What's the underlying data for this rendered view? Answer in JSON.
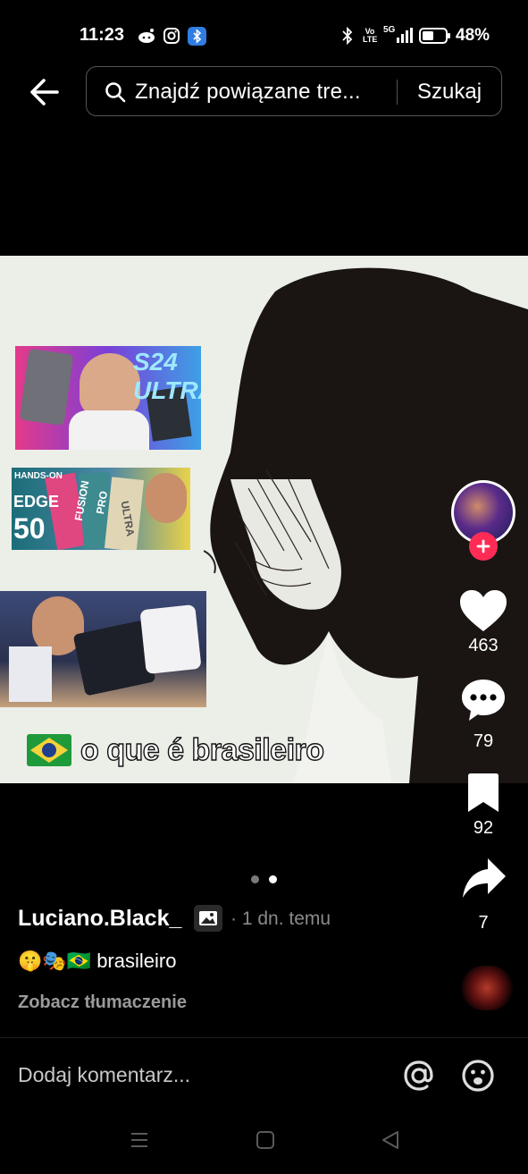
{
  "status_bar": {
    "time": "11:23",
    "network": "5G",
    "volte": "Vo LTE",
    "battery": "48%"
  },
  "search": {
    "query": "Znajdź powiązane tre...",
    "submit_label": "Szukaj"
  },
  "post": {
    "caption_overlay": "o que é brasileiro",
    "thumbnail_1_text": "S24 ULTRA",
    "thumbnail_2_labels": [
      "HANDS-ON",
      "EDGE",
      "50",
      "FUSION",
      "PRO",
      "ULTRA"
    ],
    "slide_count": 2,
    "active_slide": 2
  },
  "actions": {
    "likes": "463",
    "comments": "79",
    "saves": "92",
    "shares": "7"
  },
  "author": {
    "name": "Luciano.Black_",
    "time": "· 1 dn. temu"
  },
  "description": {
    "emojis": "🤫🎭🇧🇷",
    "text": "brasileiro"
  },
  "translate_label": "Zobacz tłumaczenie",
  "comment": {
    "placeholder": "Dodaj komentarz..."
  },
  "colors": {
    "background": "#000000",
    "accent": "#fe2c55"
  }
}
